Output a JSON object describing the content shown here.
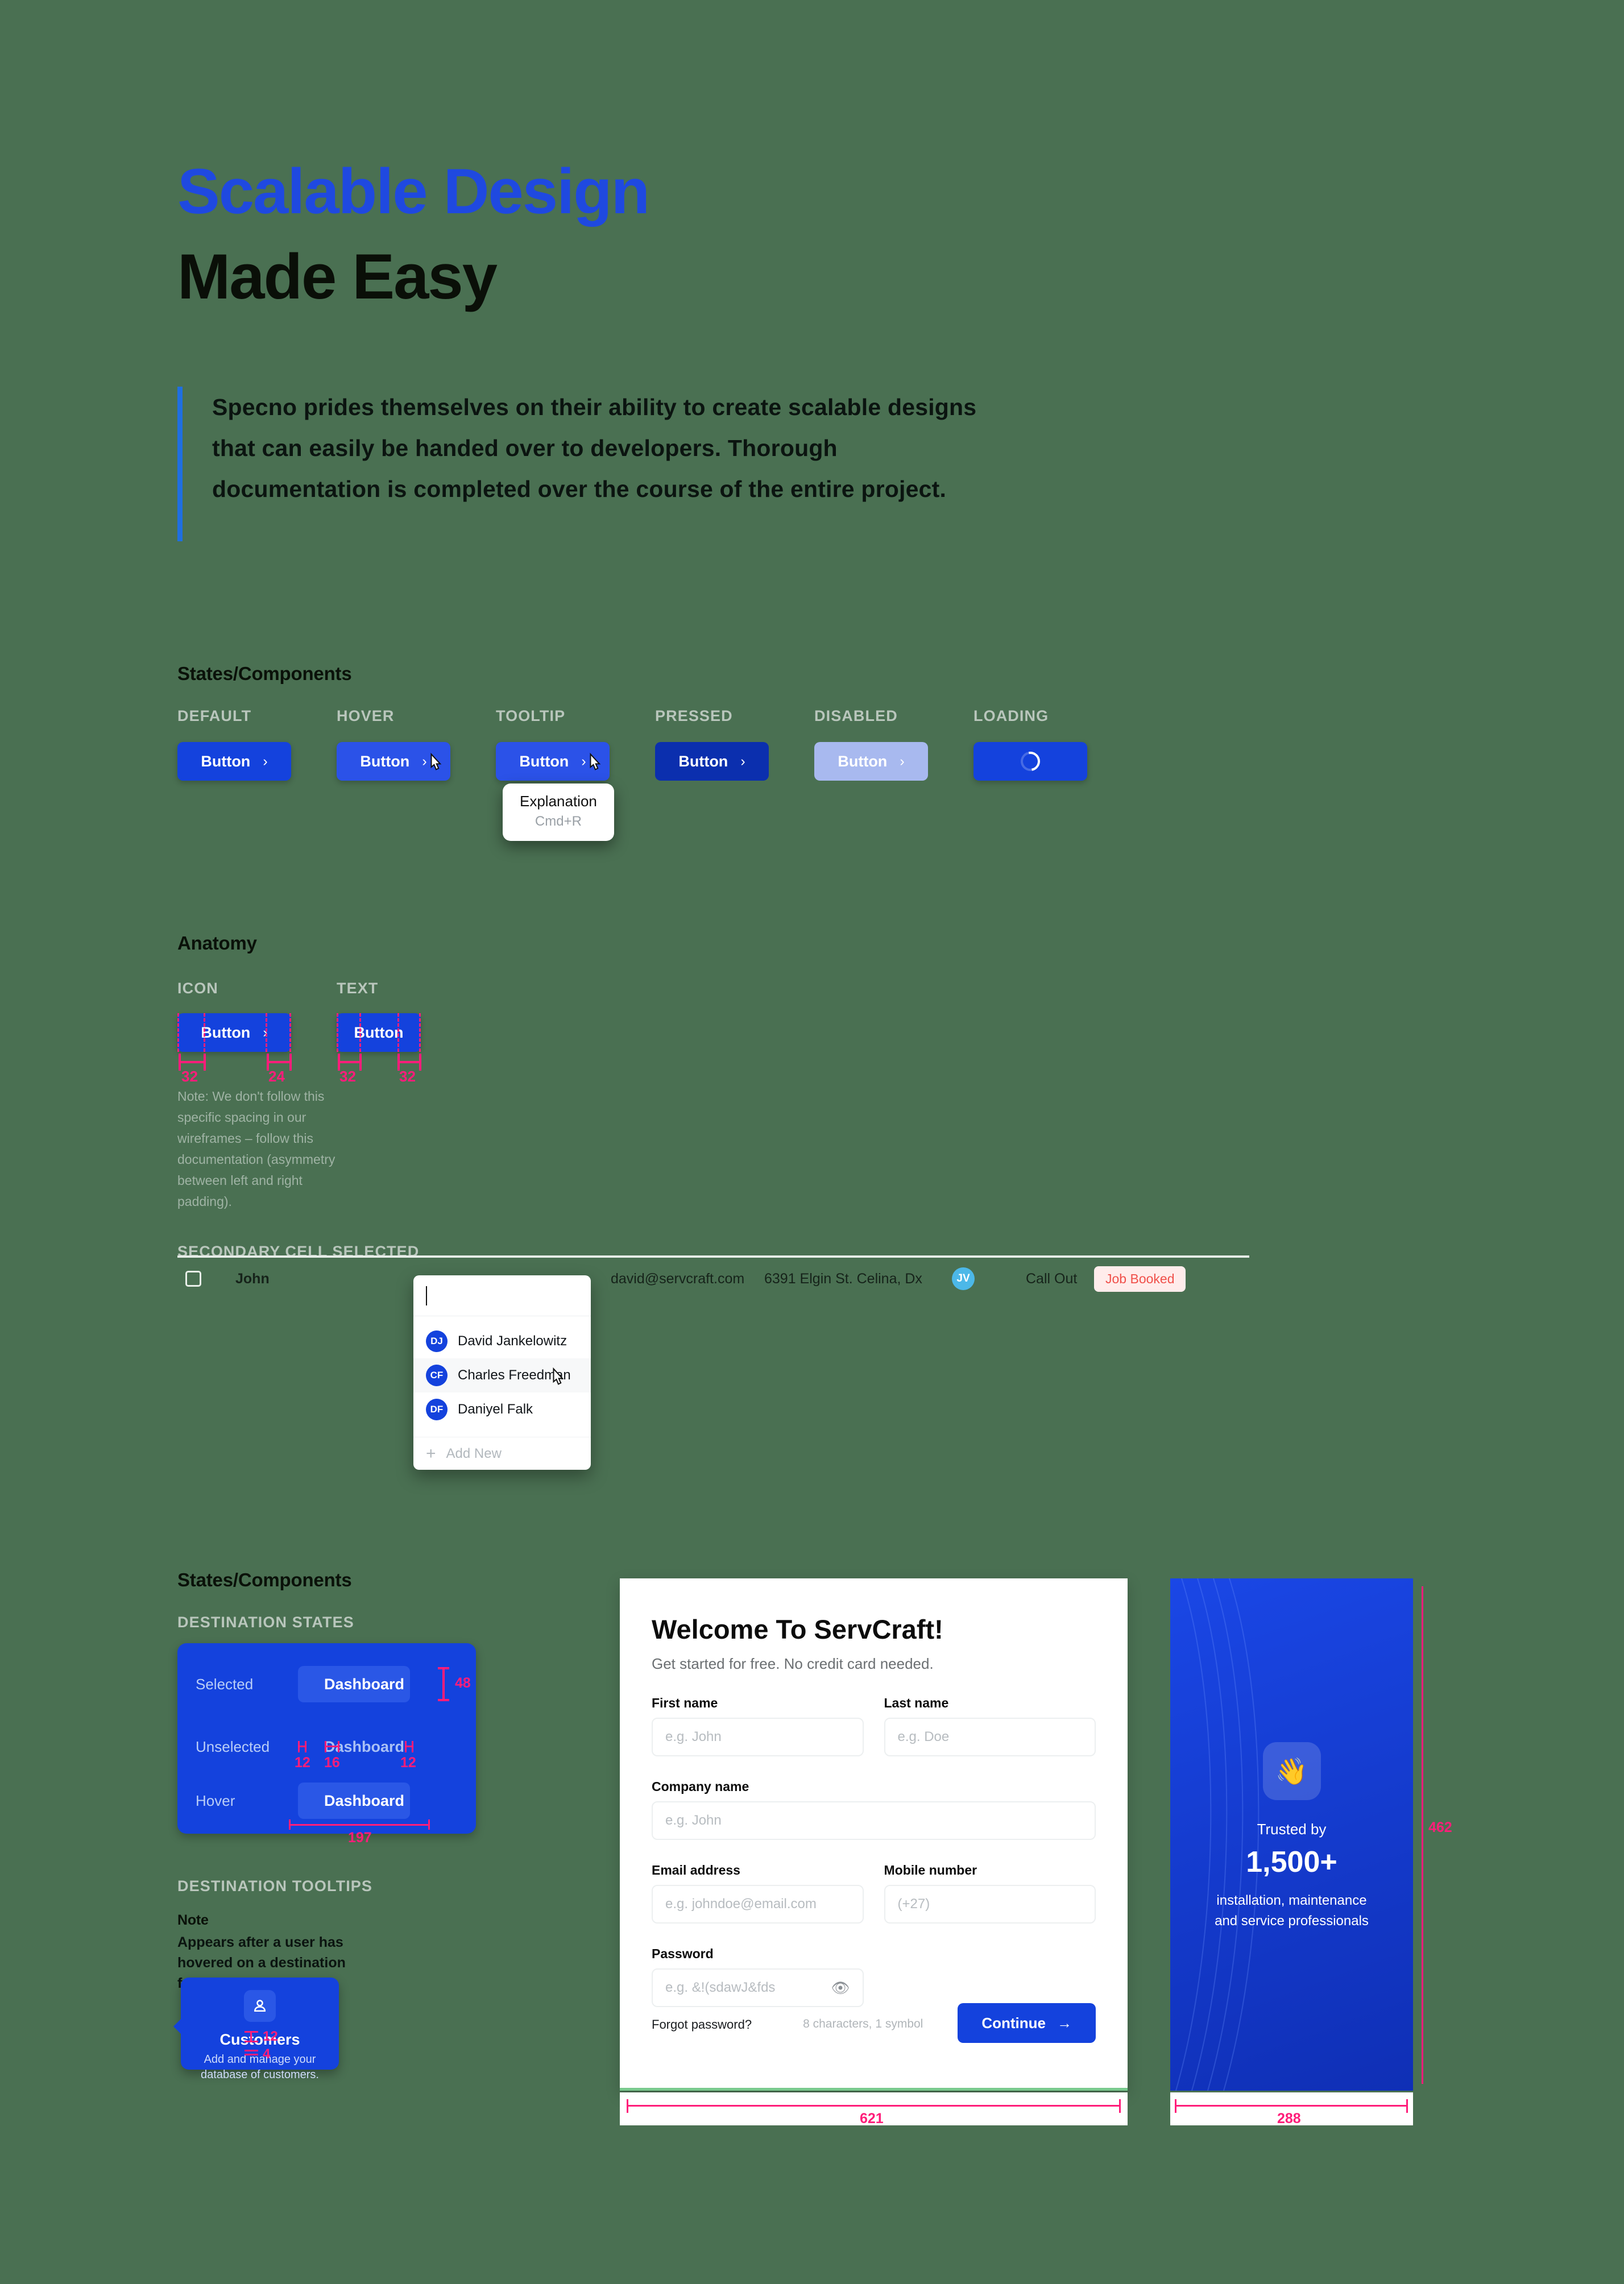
{
  "headline": {
    "line1": "Scalable Design",
    "line2": "Made Easy"
  },
  "quote": "Specno prides themselves on their ability to create scalable designs that can easily be handed over to developers. Thorough documentation is completed over the course of the entire project.",
  "sections": {
    "states_components": "States/Components",
    "anatomy": "Anatomy",
    "states_components_2": "States/Components",
    "destination_tooltips": "DESTINATION TOOLTIPS"
  },
  "buttons": {
    "states": [
      {
        "label": "DEFAULT",
        "text": "Button",
        "chev": "›"
      },
      {
        "label": "HOVER",
        "text": "Button",
        "chev": "›"
      },
      {
        "label": "TOOLTIP",
        "text": "Button",
        "chev": "›"
      },
      {
        "label": "PRESSED",
        "text": "Button",
        "chev": "›"
      },
      {
        "label": "DISABLED",
        "text": "Button",
        "chev": "›"
      },
      {
        "label": "LOADING",
        "text": "",
        "chev": ""
      }
    ],
    "tooltip": {
      "title": "Explanation",
      "shortcut": "Cmd+R"
    }
  },
  "anatomy": {
    "icon_label": "ICON",
    "text_label": "TEXT",
    "btn_text": "Button",
    "chev": "›",
    "icon_measure_left": "32",
    "icon_measure_right": "24",
    "text_measure_left": "32",
    "text_measure_right": "32",
    "note": "Note: We don't follow this specific spacing in our wireframes – follow this documentation (asymmetry between left and right padding)."
  },
  "table": {
    "section_label": "SECONDARY CELL SELECTED",
    "row": {
      "name": "John",
      "email": "david@servcraft.com",
      "address": "6391 Elgin St. Celina, Dx",
      "avatar_initials": "JV",
      "type": "Call Out",
      "status": "Job Booked"
    },
    "dropdown": {
      "input_value": "",
      "items": [
        {
          "initials": "DJ",
          "name": "David Jankelowitz"
        },
        {
          "initials": "CF",
          "name": "Charles Freedman"
        },
        {
          "initials": "DF",
          "name": "Daniyel Falk"
        }
      ],
      "add_new": "Add New",
      "plus": "+"
    }
  },
  "nav": {
    "destination_states_label": "DESTINATION STATES",
    "rows": [
      {
        "state": "Selected",
        "label": "Dashboard"
      },
      {
        "state": "Unselected",
        "label": "Dashboard"
      },
      {
        "state": "Hover",
        "label": "Dashboard"
      }
    ],
    "measure_height": "48",
    "measure_pad_left": "12",
    "measure_gap": "16",
    "measure_pad_right": "12",
    "measure_width": "197"
  },
  "destination_tooltip": {
    "note_label": "Note",
    "note_text": "Appears after a user has hovered on a destination for 2000ms.",
    "card_title": "Customers",
    "card_sub": "Add and manage your database of customers.",
    "measure_top": "12",
    "measure_bottom": "4"
  },
  "signup": {
    "title": "Welcome To ServCraft!",
    "subtitle": "Get started for free. No credit card needed.",
    "fields": [
      {
        "label": "First name",
        "placeholder": "e.g. John",
        "value": ""
      },
      {
        "label": "Last name",
        "placeholder": "e.g. Doe",
        "value": ""
      },
      {
        "label": "Company name",
        "placeholder": "e.g. John",
        "value": ""
      },
      {
        "label": "Email address",
        "placeholder": "e.g. johndoe@email.com",
        "value": ""
      },
      {
        "label": "Mobile number",
        "placeholder": "(+27)",
        "value": ""
      },
      {
        "label": "Password",
        "placeholder": "e.g. &!(sdawJ&fds",
        "value": ""
      }
    ],
    "forgot_password": "Forgot password?",
    "password_hint": "8 characters, 1 symbol",
    "continue_label": "Continue",
    "continue_arrow": "→",
    "width_measure": "621"
  },
  "promo": {
    "trusted_by": "Trusted by",
    "count": "1,500+",
    "description_line1": "installation, maintenance",
    "description_line2": "and service professionals",
    "width_measure": "288",
    "height_measure": "462"
  },
  "colors": {
    "background": "#4a7052",
    "brand_blue": "#1442dd",
    "headline_blue": "#1f49e0",
    "measure_pink": "#ff1d7a",
    "badge_red": "#f0504a",
    "badge_bg": "#ffeceb"
  }
}
